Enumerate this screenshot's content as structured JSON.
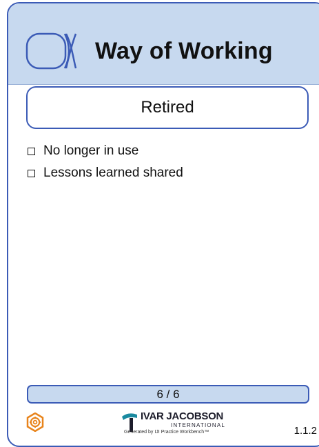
{
  "card": {
    "title": "Way of Working",
    "state": "Retired",
    "checklist": [
      {
        "label": "No longer in use",
        "checked": false
      },
      {
        "label": "Lessons learned shared",
        "checked": false
      }
    ],
    "page_counter": "6 / 6",
    "version": "1.1.2",
    "icons": [
      "alpha-icon",
      "gear-icon",
      "ivar-jacobson-logo-icon"
    ]
  },
  "brand": {
    "name": "IVAR JACOBSON",
    "sub": "INTERNATIONAL",
    "generated": "Generated by IJI Practice Workbench™"
  },
  "colors": {
    "header_bg": "#c7d9ef",
    "border": "#3b5bb6",
    "gear": "#e8841c",
    "brand_teal": "#1a8aa0"
  }
}
